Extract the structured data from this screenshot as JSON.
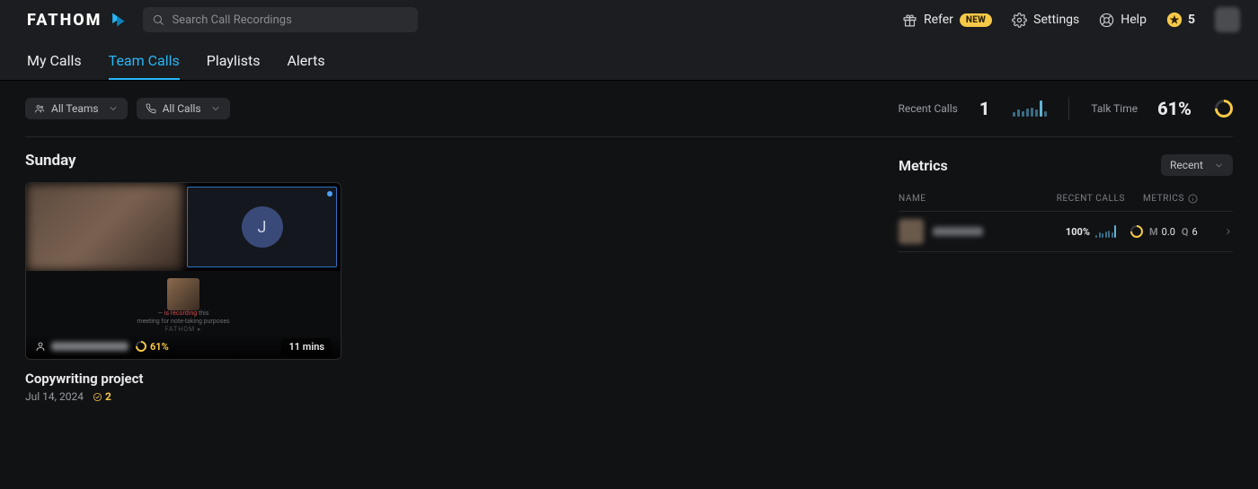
{
  "brand": {
    "name": "FATHOM"
  },
  "search": {
    "placeholder": "Search Call Recordings"
  },
  "top_links": {
    "refer": {
      "label": "Refer",
      "badge": "NEW"
    },
    "settings": {
      "label": "Settings"
    },
    "help": {
      "label": "Help"
    },
    "coins": "5"
  },
  "nav": {
    "tabs": [
      {
        "label": "My Calls",
        "active": false
      },
      {
        "label": "Team Calls",
        "active": true
      },
      {
        "label": "Playlists",
        "active": false
      },
      {
        "label": "Alerts",
        "active": false
      }
    ]
  },
  "filters": {
    "teams": {
      "label": "All Teams"
    },
    "calls": {
      "label": "All Calls"
    }
  },
  "summary": {
    "recent_calls_label": "Recent Calls",
    "recent_calls_value": "1",
    "bars": [
      4,
      6,
      5,
      7,
      8,
      6,
      14,
      5
    ],
    "talk_time_label": "Talk Time",
    "talk_time_value": "61%"
  },
  "day_heading": "Sunday",
  "card": {
    "avatar_letter": "J",
    "rec_line1": "is recording this",
    "rec_line2": "meeting for note-taking purposes",
    "talk_pct": "61%",
    "duration": "11 mins",
    "title": "Copywriting project",
    "date": "Jul 14, 2024",
    "highlights": "2"
  },
  "metrics": {
    "heading": "Metrics",
    "dropdown": "Recent",
    "col_name": "NAME",
    "col_calls": "RECENT CALLS",
    "col_metrics": "METRICS",
    "row": {
      "calls_pct": "100%",
      "bars": [
        3,
        5,
        4,
        6,
        7,
        5,
        12
      ],
      "m_label": "M",
      "m_value": "0.0",
      "q_label": "Q",
      "q_value": "6"
    }
  }
}
